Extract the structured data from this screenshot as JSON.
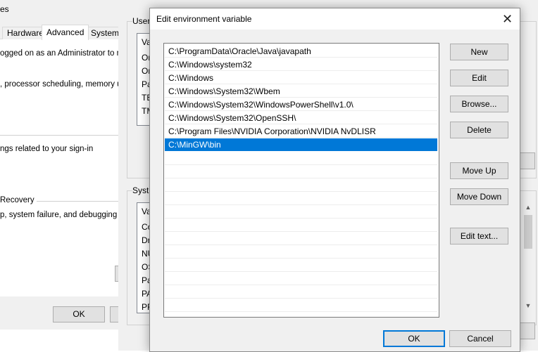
{
  "system_properties": {
    "title_fragment": "es",
    "tabs": [
      "Hardware",
      "Advanced",
      "System P"
    ],
    "active_tab": "Advanced",
    "admin_note": "ogged on as an Administrator to mak",
    "performance_text": ", processor scheduling, memory usa",
    "profiles_text": "ngs related to your sign-in",
    "startup_group_label": "Recovery",
    "startup_text": "p, system failure, and debugging inf",
    "ok_label": "OK",
    "cancel_label": ""
  },
  "environment_variables": {
    "user_group_label": "User",
    "user_rows": [
      "Va",
      "Or",
      "Or",
      "Pa",
      "TE",
      "TM"
    ],
    "system_group_label": "Syste",
    "system_rows": [
      "Va",
      "Co",
      "Dr",
      "NU",
      "OS",
      "Pa",
      "PA",
      "PR"
    ]
  },
  "dialog": {
    "title": "Edit environment variable",
    "close_glyph": "✕",
    "paths": [
      "C:\\ProgramData\\Oracle\\Java\\javapath",
      "C:\\Windows\\system32",
      "C:\\Windows",
      "C:\\Windows\\System32\\Wbem",
      "C:\\Windows\\System32\\WindowsPowerShell\\v1.0\\",
      "C:\\Windows\\System32\\OpenSSH\\",
      "C:\\Program Files\\NVIDIA Corporation\\NVIDIA NvDLISR",
      "C:\\MinGW\\bin"
    ],
    "selected_index": 7,
    "buttons": {
      "new": "New",
      "edit": "Edit",
      "browse": "Browse...",
      "delete": "Delete",
      "move_up": "Move Up",
      "move_down": "Move Down",
      "edit_text": "Edit text...",
      "ok": "OK",
      "cancel": "Cancel"
    }
  },
  "colors": {
    "selection": "#0078d7",
    "window_bg": "#f0f0f0",
    "button_bg": "#e1e1e1"
  }
}
